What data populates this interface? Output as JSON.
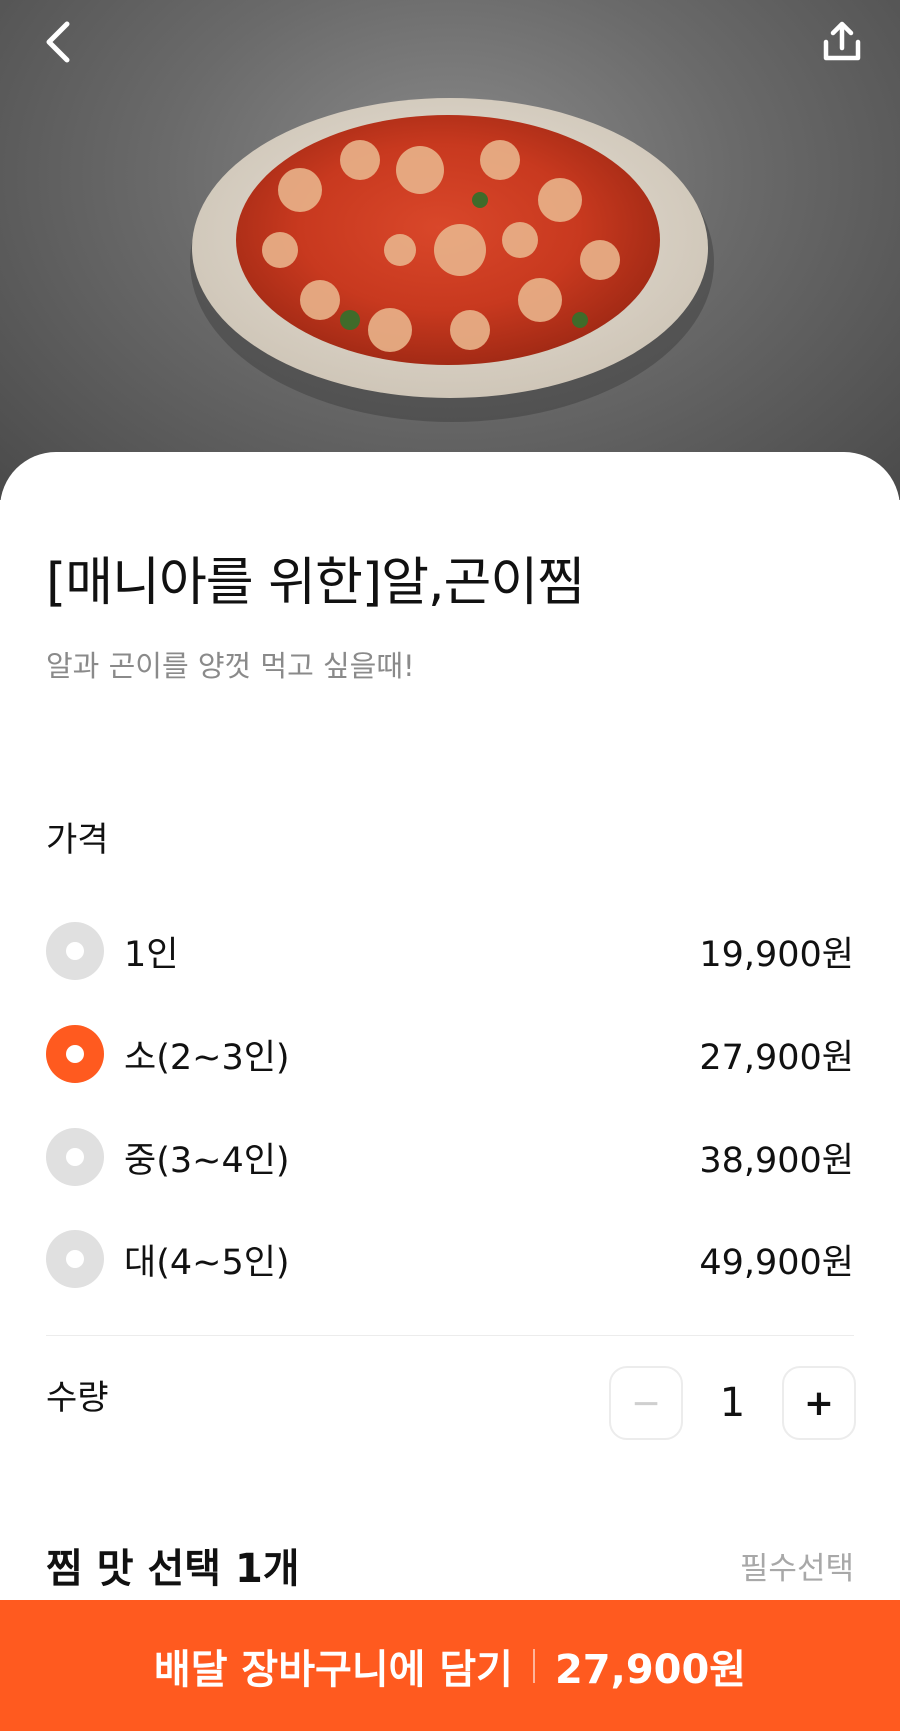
{
  "menu": {
    "name": "[매니아를 위한]알,곤이찜",
    "description": "알과 곤이를 양껏 먹고 싶을때!"
  },
  "price": {
    "label": "가격",
    "options": [
      {
        "name": "1인",
        "price": "19,900원",
        "selected": false
      },
      {
        "name": "소(2~3인)",
        "price": "27,900원",
        "selected": true
      },
      {
        "name": "중(3~4인)",
        "price": "38,900원",
        "selected": false
      },
      {
        "name": "대(4~5인)",
        "price": "49,900원",
        "selected": false
      }
    ]
  },
  "quantity": {
    "label": "수량",
    "value": "1",
    "minus": "−",
    "plus": "+"
  },
  "taste": {
    "title": "찜 맛 선택 1개",
    "required": "필수선택"
  },
  "cta": {
    "label": "배달 장바구니에 담기",
    "price": "27,900원"
  },
  "colors": {
    "accent": "#ff5a1f",
    "radio_off": "#e0e0e0"
  },
  "icons": [
    "back-icon",
    "share-icon"
  ]
}
